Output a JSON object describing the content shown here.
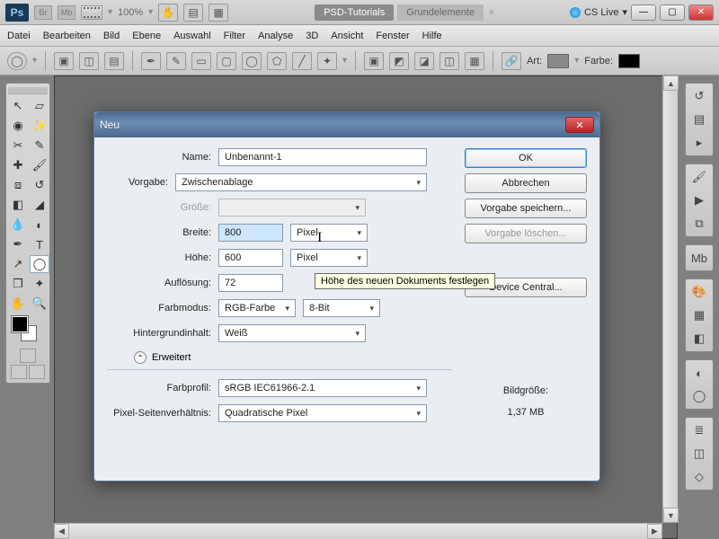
{
  "app": {
    "logo": "Ps",
    "zoom": "100%",
    "tabs": [
      "PSD-Tutorials",
      "Grundelemente"
    ],
    "cslive": "CS Live"
  },
  "menu": [
    "Datei",
    "Bearbeiten",
    "Bild",
    "Ebene",
    "Auswahl",
    "Filter",
    "Analyse",
    "3D",
    "Ansicht",
    "Fenster",
    "Hilfe"
  ],
  "options": {
    "art": "Art:",
    "farbe": "Farbe:"
  },
  "dialog": {
    "title": "Neu",
    "name_label": "Name:",
    "name_value": "Unbenannt-1",
    "vorgabe_label": "Vorgabe:",
    "vorgabe_value": "Zwischenablage",
    "groesse_label": "Größe:",
    "breite_label": "Breite:",
    "breite_value": "800",
    "hoehe_label": "Höhe:",
    "hoehe_value": "600",
    "unit_pixel": "Pixel",
    "aufloesung_label": "Auflösung:",
    "aufloesung_value": "72",
    "farbmodus_label": "Farbmodus:",
    "farbmodus_value": "RGB-Farbe",
    "bits_value": "8-Bit",
    "hintergrund_label": "Hintergrundinhalt:",
    "hintergrund_value": "Weiß",
    "erweitert": "Erweitert",
    "farbprofil_label": "Farbprofil:",
    "farbprofil_value": "sRGB IEC61966-2.1",
    "aspect_label": "Pixel-Seitenverhältnis:",
    "aspect_value": "Quadratische Pixel",
    "ok": "OK",
    "abbrechen": "Abbrechen",
    "vorgabe_speichern": "Vorgabe speichern...",
    "vorgabe_loeschen": "Vorgabe löschen...",
    "device_central": "Device Central...",
    "bildgroesse_label": "Bildgröße:",
    "bildgroesse_value": "1,37 MB",
    "tooltip": "Höhe des neuen Dokuments festlegen"
  }
}
